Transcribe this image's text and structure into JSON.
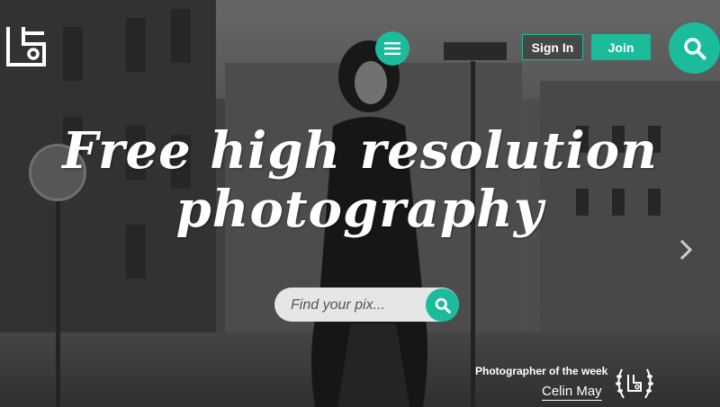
{
  "header": {
    "logo_icon": "unsplash-style-logo-icon",
    "menu_icon": "hamburger-menu-icon",
    "signin_label": "Sign In",
    "join_label": "Join",
    "search_icon": "search-icon"
  },
  "hero": {
    "headline_line1": "Free high resolution",
    "headline_line2": "photography"
  },
  "search": {
    "placeholder": "Find your pix...",
    "value": ""
  },
  "carousel": {
    "next_icon": "chevron-right-icon"
  },
  "photographer_of_week": {
    "label": "Photographer of the week",
    "name": "Celin May",
    "badge_icon": "laurel-badge-icon"
  },
  "colors": {
    "accent": "#1abc9c"
  }
}
